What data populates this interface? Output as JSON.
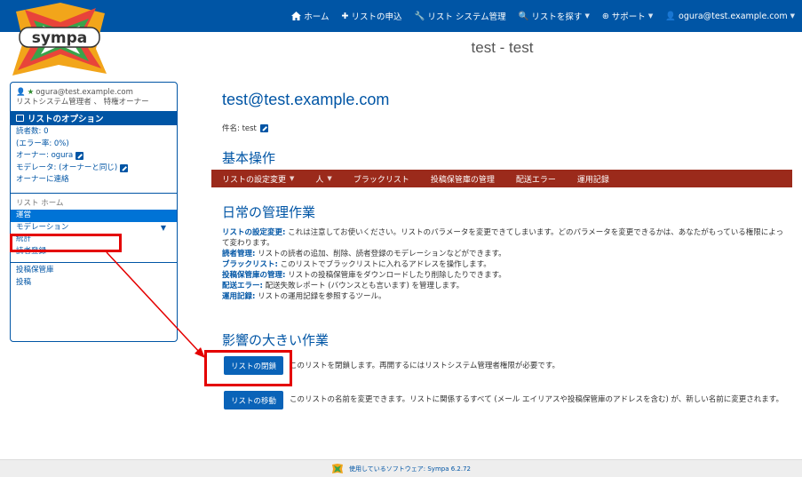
{
  "topnav": {
    "home": "ホーム",
    "request_list": "リストの申込",
    "list_admin": "リスト システム管理",
    "find_list": "リストを探す",
    "support": "サポート",
    "user": "ogura@test.example.com"
  },
  "logo_text": "sympa",
  "page_title": "test - test",
  "sidebar": {
    "user_email": "ogura@test.example.com",
    "user_role": "リストシステム管理者 、 特権オーナー",
    "options_title": "リストのオプション",
    "subscribers": "読者数: 0",
    "error_rate": "(エラー率: 0%)",
    "owner": "オーナー: ogura",
    "moderator": "モデレータ: (オーナーと同じ)",
    "contact_owner": "オーナーに連絡",
    "list_home": "リスト ホーム",
    "admin": "運営",
    "moderation": "モデレーション",
    "stats": "統計",
    "subscribe": "読者登録",
    "archive": "投稿保管庫",
    "post": "投稿"
  },
  "main": {
    "email_title": "test@test.example.com",
    "subject_label": "件名: test",
    "basic_heading": "基本操作",
    "menu": [
      "リストの設定変更",
      "人",
      "ブラックリスト",
      "投稿保管庫の管理",
      "配送エラー",
      "運用記録"
    ],
    "daily_heading": "日常の管理作業",
    "desc": [
      {
        "term": "リストの設定変更:",
        "text": " これは注意してお使いください。リストのパラメータを変更できてしまいます。どのパラメータを変更できるかは、あなたがもっている権限によって変わります。"
      },
      {
        "term": "読者管理:",
        "text": " リストの読者の追加、削除、読者登録のモデレーションなどができます。"
      },
      {
        "term": "ブラックリスト:",
        "text": " このリストでブラックリストに入れるアドレスを操作します。"
      },
      {
        "term": "投稿保管庫の管理:",
        "text": " リストの投稿保管庫をダウンロードしたり削除したりできます。"
      },
      {
        "term": "配送エラー:",
        "text": " 配送失敗レポート (バウンスとも言います) を管理します。"
      },
      {
        "term": "運用記録:",
        "text": " リストの運用記録を参照するツール。"
      }
    ],
    "impact_heading": "影響の大きい作業",
    "close_button": "リストの閉鎖",
    "close_desc": "このリストを閉鎖します。再開するにはリストシステム管理者権限が必要です。",
    "rename_button": "リストの移動",
    "rename_desc": "このリストの名前を変更できます。リストに関係するすべて (メール エイリアスや投稿保管庫のアドレスを含む) が、新しい名前に変更されます。"
  },
  "footer": "使用しているソフトウェア: Sympa 6.2.72",
  "colors": {
    "brand": "#0055a5",
    "menu_bar": "#9b2a1b",
    "highlight": "#e40000"
  }
}
